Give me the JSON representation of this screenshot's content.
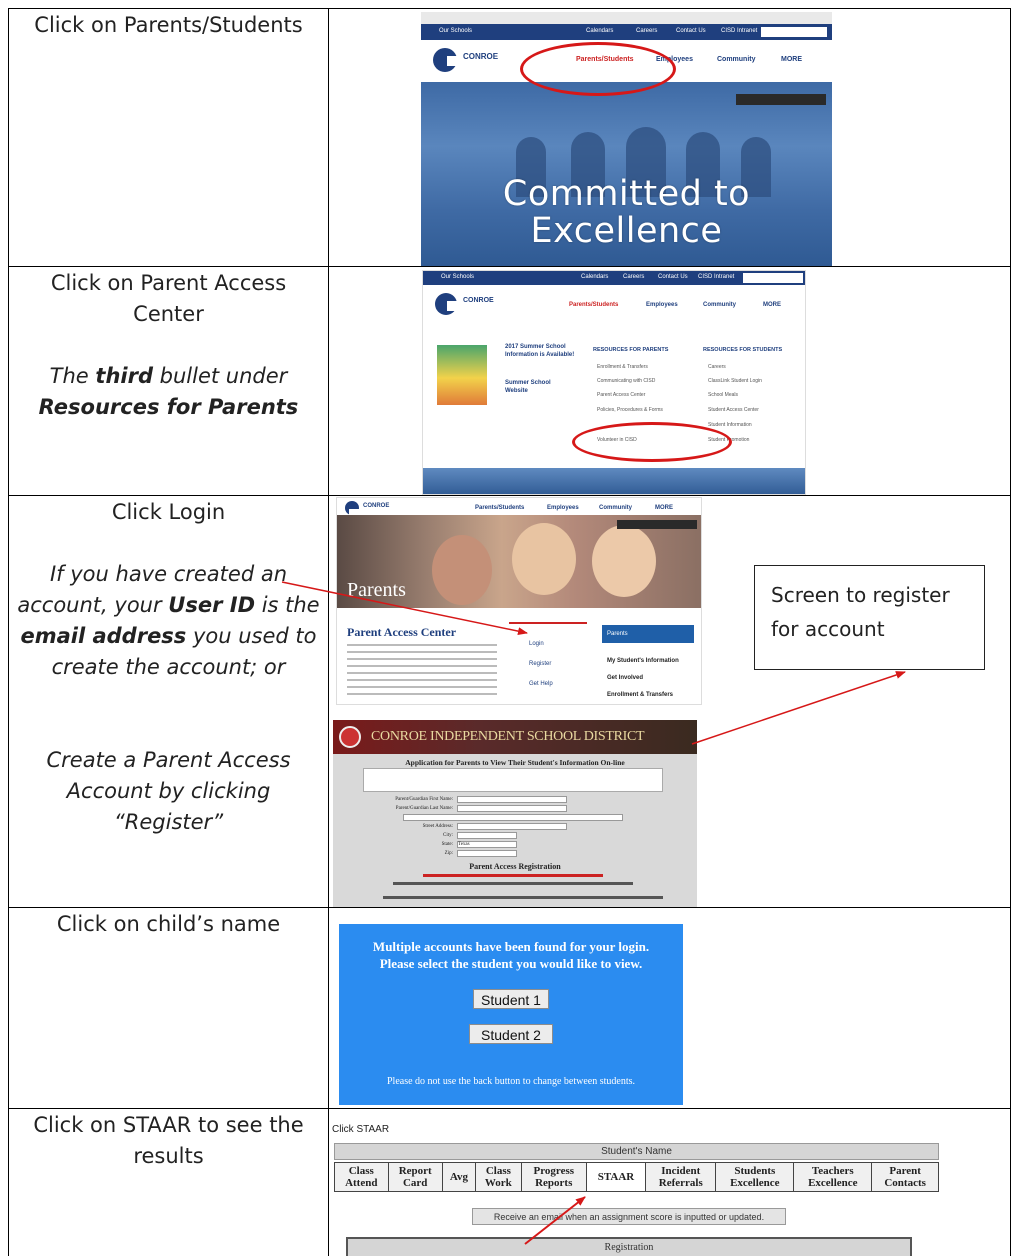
{
  "steps": [
    {
      "lines": [
        {
          "text": "Click on Parents/Students",
          "style": "normal"
        }
      ]
    },
    {
      "lines": [
        {
          "text": "Click on Parent Access",
          "style": "normal"
        },
        {
          "text": "Center",
          "style": "normal"
        },
        {
          "text": "",
          "style": "gap"
        },
        {
          "text": "The third bullet under",
          "style": "italic"
        },
        {
          "text": "Resources for Parents",
          "style": "bolditalic"
        }
      ]
    },
    {
      "lines": [
        {
          "text": "Click Login",
          "style": "normal"
        },
        {
          "text": "",
          "style": "gap"
        },
        {
          "text": "If you have created an",
          "style": "italic"
        },
        {
          "text": "account, your User ID is the",
          "style": "italic"
        },
        {
          "text": "email address you used to",
          "style": "italic"
        },
        {
          "text": "create the account; or",
          "style": "italic"
        },
        {
          "text": "",
          "style": "gap"
        },
        {
          "text": "",
          "style": "gap"
        },
        {
          "text": "Create a Parent Access",
          "style": "italic"
        },
        {
          "text": "Account by clicking",
          "style": "italic"
        },
        {
          "text": "“Register”",
          "style": "italic"
        }
      ]
    },
    {
      "lines": [
        {
          "text": "Click on child’s name",
          "style": "normal"
        }
      ]
    },
    {
      "lines": [
        {
          "text": "Click on STAAR to see the",
          "style": "normal"
        },
        {
          "text": "results",
          "style": "normal"
        }
      ]
    }
  ],
  "callout": {
    "line1": "Screen to register",
    "line2": "for account"
  },
  "shot1": {
    "nav_items": [
      "Parents/Students",
      "Employees",
      "Community",
      "MORE"
    ],
    "logo_text": "CONROE",
    "hero_line1": "Committed to",
    "hero_line2": "Excellence",
    "top_links": [
      "Calendars",
      "Careers",
      "Contact Us",
      "CISD Intranet"
    ],
    "schools_label": "Our Schools"
  },
  "shot2": {
    "nav_items": [
      "Parents/Students",
      "Employees",
      "Community",
      "MORE"
    ],
    "logo_text": "CONROE",
    "promo_title": "2017 Summer School Information is Available!",
    "promo_link": "Summer School Website",
    "col_parents_title": "RESOURCES FOR PARENTS",
    "col_parents": [
      "Enrollment & Transfers",
      "Communicating with CISD",
      "Parent Access Center",
      "Policies, Procedures & Forms",
      "Volunteer in CISD"
    ],
    "col_students_title": "RESOURCES FOR STUDENTS",
    "col_students": [
      "Careers",
      "ClassLink Student Login",
      "School Meals",
      "Student Access Center",
      "Student Information",
      "Student Promotion"
    ]
  },
  "shot3": {
    "nav_items": [
      "Parents/Students",
      "Employees",
      "Community",
      "MORE"
    ],
    "banner_title": "Parents",
    "section_title": "Parent Access Center",
    "links": [
      "Login",
      "Register",
      "Get Help"
    ],
    "side_title": "Parents",
    "side_items": [
      "My Student's Information",
      "Get Involved",
      "Enrollment & Transfers"
    ],
    "district_banner": "CONROE INDEPENDENT SCHOOL DISTRICT",
    "form_title": "Application for Parents to View Their Student's Information On-line",
    "form_fields": [
      "Parent/Guardian First Name:",
      "Parent/Guardian Last Name:",
      "Street Address:",
      "City:",
      "State:",
      "Zip:"
    ],
    "state_value": "Texas",
    "reg_title": "Parent Access Registration"
  },
  "shot4": {
    "message_line1": "Multiple accounts have been found for your login.",
    "message_line2": "Please select the student you would like to view.",
    "students": [
      "Student 1",
      "Student 2"
    ],
    "footer_note": "Please do not use the back button to change between students."
  },
  "shot5": {
    "caption": "Click STAAR",
    "student_name": "Student's Name",
    "tabs": [
      {
        "line1": "Class",
        "line2": "Attend"
      },
      {
        "line1": "Report",
        "line2": "Card"
      },
      {
        "line1": "Avg",
        "line2": ""
      },
      {
        "line1": "Class",
        "line2": "Work"
      },
      {
        "line1": "Progress",
        "line2": "Reports"
      },
      {
        "line1": "STAAR",
        "line2": ""
      },
      {
        "line1": "Incident",
        "line2": "Referrals"
      },
      {
        "line1": "Students",
        "line2": "Excellence"
      },
      {
        "line1": "Teachers",
        "line2": "Excellence"
      },
      {
        "line1": "Parent",
        "line2": "Contacts"
      }
    ],
    "email_button": "Receive an email when an assignment score is inputted or updated.",
    "registration": "Registration"
  },
  "colors": {
    "ring": "#d61818",
    "arrow": "#d61818",
    "district_blue": "#1f3f7e",
    "panel_blue": "#2b8cf0"
  }
}
